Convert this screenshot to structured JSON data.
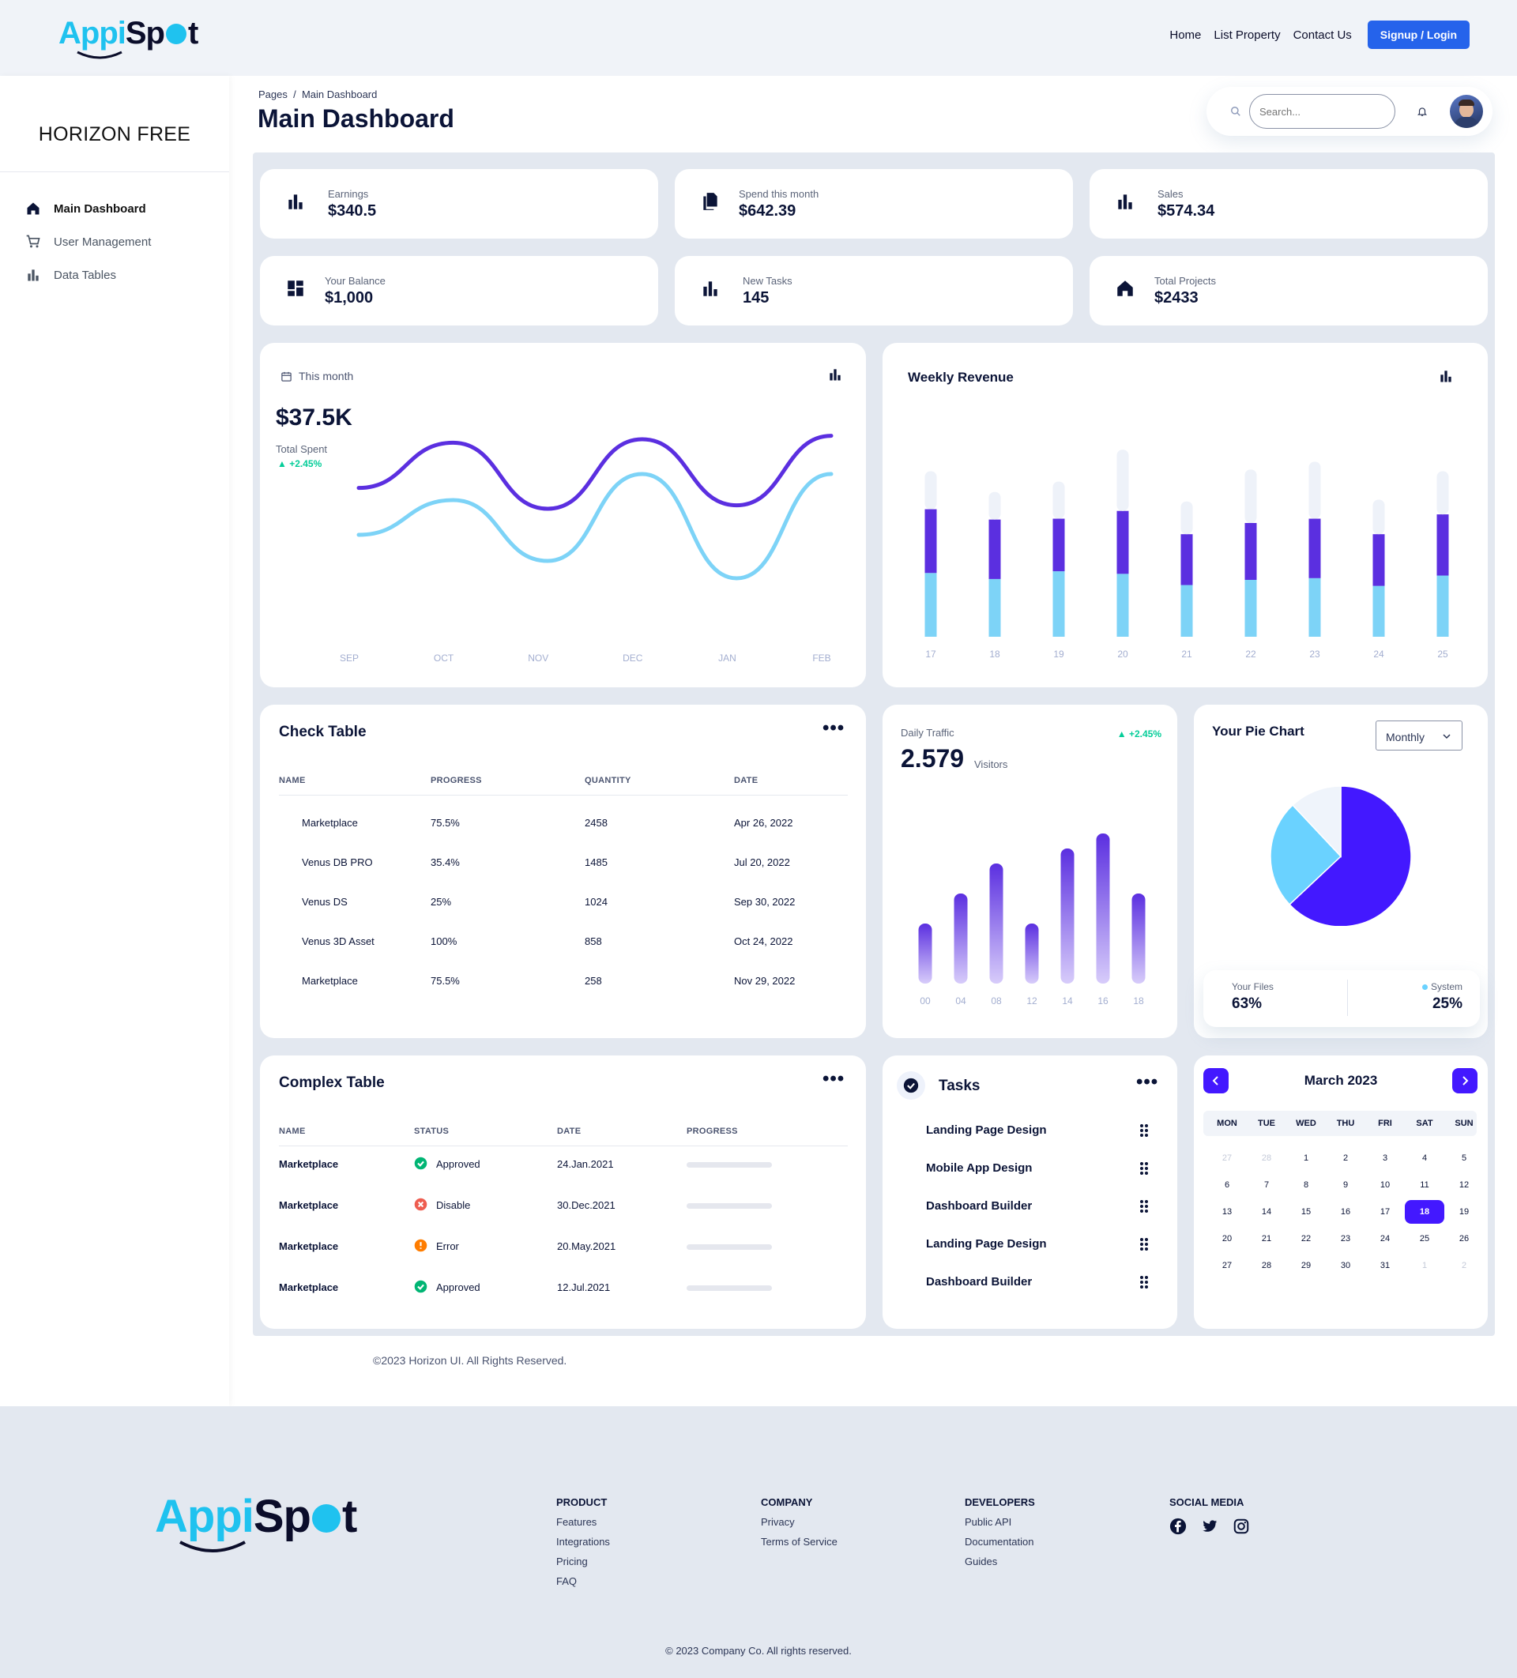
{
  "topbar": {
    "logo_prefix": "Appi",
    "logo_suffix_1": "Sp",
    "logo_suffix_2": "t",
    "nav": [
      "Home",
      "List Property",
      "Contact Us"
    ],
    "login": "Signup / Login"
  },
  "sidebar": {
    "brand": "HORIZON FREE",
    "items": [
      {
        "label": "Main Dashboard",
        "icon": "home-icon"
      },
      {
        "label": "User Management",
        "icon": "cart-icon"
      },
      {
        "label": "Data Tables",
        "icon": "bar-chart-icon"
      }
    ]
  },
  "header": {
    "breadcrumb_root": "Pages",
    "breadcrumb_sep": "/",
    "breadcrumb_current": "Main Dashboard",
    "title": "Main Dashboard",
    "search_placeholder": "Search..."
  },
  "stats": [
    {
      "label": "Earnings",
      "value": "$340.5",
      "icon": "bar-chart-icon"
    },
    {
      "label": "Spend this month",
      "value": "$642.39",
      "icon": "documents-icon"
    },
    {
      "label": "Sales",
      "value": "$574.34",
      "icon": "bar-chart-icon"
    },
    {
      "label": "Your Balance",
      "value": "$1,000",
      "icon": "dashboard-icon"
    },
    {
      "label": "New Tasks",
      "value": "145",
      "icon": "bar-chart-icon"
    },
    {
      "label": "Total Projects",
      "value": "$2433",
      "icon": "home-icon"
    }
  ],
  "total_spent": {
    "period": "This month",
    "value": "$37.5K",
    "label": "Total Spent",
    "change": "+2.45%"
  },
  "weekly_revenue": {
    "title": "Weekly Revenue"
  },
  "check_table": {
    "title": "Check Table",
    "columns": [
      "NAME",
      "PROGRESS",
      "QUANTITY",
      "DATE"
    ],
    "rows": [
      [
        "Marketplace",
        "75.5%",
        "2458",
        "Apr 26, 2022"
      ],
      [
        "Venus DB PRO",
        "35.4%",
        "1485",
        "Jul 20, 2022"
      ],
      [
        "Venus DS",
        "25%",
        "1024",
        "Sep 30, 2022"
      ],
      [
        "Venus 3D Asset",
        "100%",
        "858",
        "Oct 24, 2022"
      ],
      [
        "Marketplace",
        "75.5%",
        "258",
        "Nov 29, 2022"
      ]
    ]
  },
  "daily_traffic": {
    "label": "Daily Traffic",
    "value": "2.579",
    "unit": "Visitors",
    "change": "+2.45%"
  },
  "pie": {
    "title": "Your Pie Chart",
    "select": "Monthly",
    "files_label": "Your Files",
    "files_value": "63%",
    "system_label": "System",
    "system_value": "25%"
  },
  "complex_table": {
    "title": "Complex Table",
    "columns": [
      "NAME",
      "STATUS",
      "DATE",
      "PROGRESS"
    ],
    "rows": [
      {
        "name": "Marketplace",
        "status": "Approved",
        "date": "24.Jan.2021",
        "progress": 0
      },
      {
        "name": "Marketplace",
        "status": "Disable",
        "date": "30.Dec.2021",
        "progress": 0
      },
      {
        "name": "Marketplace",
        "status": "Error",
        "date": "20.May.2021",
        "progress": 0
      },
      {
        "name": "Marketplace",
        "status": "Approved",
        "date": "12.Jul.2021",
        "progress": 0
      }
    ]
  },
  "tasks": {
    "title": "Tasks",
    "items": [
      "Landing Page Design",
      "Mobile App Design",
      "Dashboard Builder",
      "Landing Page Design",
      "Dashboard Builder"
    ]
  },
  "calendar": {
    "title": "March 2023",
    "days": [
      "MON",
      "TUE",
      "WED",
      "THU",
      "FRI",
      "SAT",
      "SUN"
    ],
    "selected": "18",
    "weeks": [
      [
        "27",
        "28",
        "1",
        "2",
        "3",
        "4",
        "5"
      ],
      [
        "6",
        "7",
        "8",
        "9",
        "10",
        "11",
        "12"
      ],
      [
        "13",
        "14",
        "15",
        "16",
        "17",
        "18",
        "19"
      ],
      [
        "20",
        "21",
        "22",
        "23",
        "24",
        "25",
        "26"
      ],
      [
        "27",
        "28",
        "29",
        "30",
        "31",
        "1",
        "2"
      ]
    ]
  },
  "copyright": "©2023 Horizon UI. All Rights Reserved.",
  "footer": {
    "columns": [
      {
        "title": "PRODUCT",
        "links": [
          "Features",
          "Integrations",
          "Pricing",
          "FAQ"
        ]
      },
      {
        "title": "COMPANY",
        "links": [
          "Privacy",
          "Terms of Service"
        ]
      },
      {
        "title": "DEVELOPERS",
        "links": [
          "Public API",
          "Documentation",
          "Guides"
        ]
      },
      {
        "title": "SOCIAL MEDIA",
        "links": []
      }
    ],
    "social": [
      "facebook-icon",
      "twitter-icon",
      "instagram-icon"
    ],
    "copyright": "© 2023 Company Co. All rights reserved."
  },
  "chart_data": [
    {
      "type": "line",
      "title": "",
      "x": [
        "SEP",
        "OCT",
        "NOV",
        "DEC",
        "JAN",
        "FEB"
      ],
      "series": [
        {
          "values": [
            62,
            88,
            50,
            90,
            52,
            92
          ]
        },
        {
          "values": [
            35,
            55,
            20,
            70,
            10,
            70
          ]
        }
      ],
      "colors": [
        "#5b2fe0",
        "#7dd3f7"
      ]
    },
    {
      "type": "bar",
      "title": "Weekly Revenue",
      "categories": [
        "17",
        "18",
        "19",
        "20",
        "21",
        "22",
        "23",
        "24",
        "25"
      ],
      "series": [
        {
          "values": [
            74,
            67,
            76,
            73,
            60,
            66,
            68,
            59,
            71
          ]
        },
        {
          "values": [
            74,
            69,
            61,
            73,
            59,
            66,
            69,
            60,
            71
          ]
        },
        {
          "values": [
            44,
            32,
            43,
            71,
            38,
            62,
            66,
            40,
            50
          ]
        }
      ],
      "colors": [
        "#7dd3f7",
        "#5b2fe0",
        "#eef2f9"
      ]
    },
    {
      "type": "bar",
      "title": "Daily Traffic",
      "categories": [
        "00",
        "04",
        "08",
        "12",
        "14",
        "16",
        "18"
      ],
      "values": [
        40,
        60,
        80,
        40,
        90,
        100,
        60
      ],
      "colors": [
        "#5b2fe0"
      ]
    },
    {
      "type": "pie",
      "title": "Your Pie Chart",
      "values": [
        63,
        25,
        12
      ],
      "colors": [
        "#4318ff",
        "#6ad2ff",
        "#eff4fb"
      ]
    }
  ]
}
